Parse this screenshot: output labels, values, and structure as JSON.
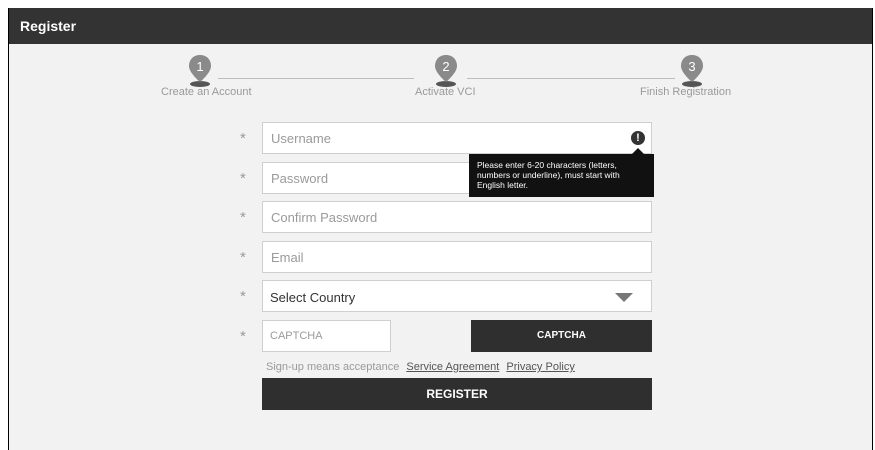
{
  "window": {
    "title": "Register"
  },
  "steps": [
    {
      "number": "1",
      "label": "Create an Account"
    },
    {
      "number": "2",
      "label": "Activate VCI"
    },
    {
      "number": "3",
      "label": "Finish Registration"
    }
  ],
  "required_marker": "*",
  "form": {
    "username_placeholder": "Username",
    "password_placeholder": "Password",
    "confirm_password_placeholder": "Confirm Password",
    "email_placeholder": "Email",
    "country_selected": "Select Country",
    "captcha_placeholder": "CAPTCHA",
    "captcha_button": "CAPTCHA",
    "register_button": "REGISTER"
  },
  "username_error_tooltip": "Please enter 6-20 characters (letters, numbers or underline), must start with English letter.",
  "error_icon_glyph": "!",
  "agreement": {
    "prefix": "Sign-up means acceptance",
    "service_link": "Service Agreement",
    "privacy_link": "Privacy Policy"
  },
  "colors": {
    "titlebar": "#333333",
    "button": "#2f2f2f",
    "background": "#f2f2f2"
  }
}
